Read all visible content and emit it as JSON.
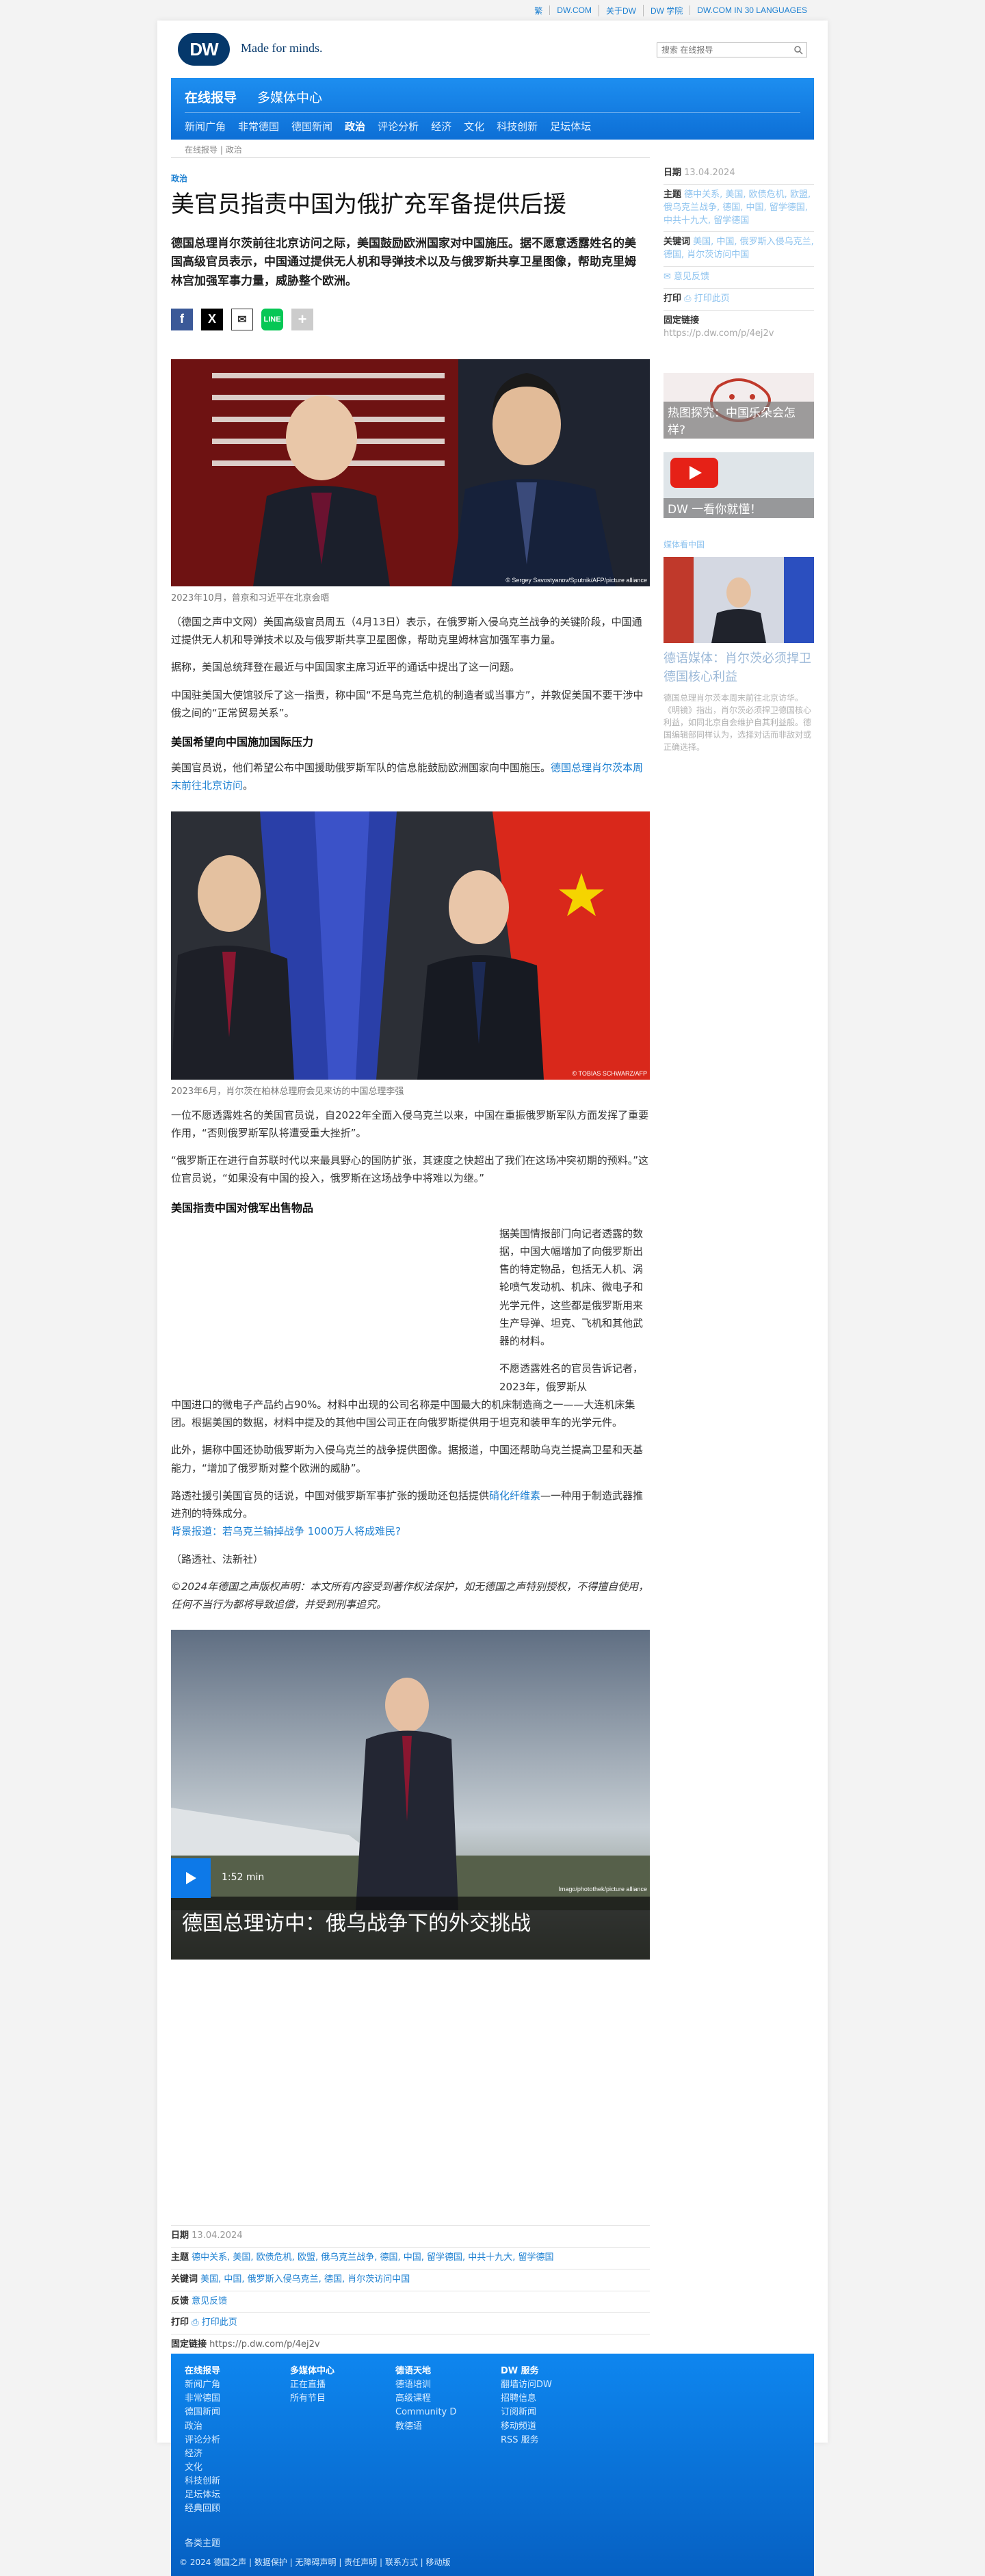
{
  "toplinks": [
    "繁",
    "DW.COM",
    "关于DW",
    "DW 学院",
    "DW.COM IN 30 LANGUAGES"
  ],
  "header": {
    "logo_text": "DW",
    "tagline": "Made for minds.",
    "search_placeholder": "搜索 在线报导"
  },
  "nav": {
    "title": "在线报导",
    "media": "多媒体中心",
    "items": [
      "新闻广角",
      "非常德国",
      "德国新闻",
      "政治",
      "评论分析",
      "经济",
      "文化",
      "科技创新",
      "足坛体坛"
    ],
    "active": "政治"
  },
  "breadcrumb": {
    "home": "在线报导",
    "sep": "|",
    "current": "政治"
  },
  "article": {
    "kicker": "政治",
    "headline": "美官员指责中国为俄扩充军备提供后援",
    "lead": "德国总理肖尔茨前往北京访问之际，美国鼓励欧洲国家对中国施压。据不愿意透露姓名的美国高级官员表示，中国通过提供无人机和导弹技术以及与俄罗斯共享卫星图像，帮助克里姆林宫加强军事力量，威胁整个欧洲。",
    "image1": {
      "caption": "2023年10月，普京和习近平在北京会晤",
      "credit": "© Sergey Savostyanov/Sputnik/AFP/picture alliance"
    },
    "p1": "（德国之声中文网）美国高级官员周五（4月13日）表示，在俄罗斯入侵乌克兰战争的关键阶段，中国通过提供无人机和导弹技术以及与俄罗斯共享卫星图像，帮助克里姆林宫加强军事力量。",
    "p2": "据称，美国总统拜登在最近与中国国家主席习近平的通话中提出了这一问题。",
    "p3": "中国驻美国大使馆驳斥了这一指责，称中国“不是乌克兰危机的制造者或当事方”，并敦促美国不要干涉中俄之间的“正常贸易关系”。",
    "sub1": "美国希望向中国施加国际压力",
    "p4_text": "美国官员说，他们希望公布中国援助俄罗斯军队的信息能鼓励欧洲国家向中国施压。",
    "p4_link": "德国总理肖尔茨本周末前往北京访问",
    "p4_end": "。",
    "image2": {
      "caption": "2023年6月，肖尔茨在柏林总理府会见来访的中国总理李强",
      "credit": "© TOBIAS SCHWARZ/AFP"
    },
    "p5": "一位不愿透露姓名的美国官员说，自2022年全面入侵乌克兰以来，中国在重振俄罗斯军队方面发挥了重要作用，“否则俄罗斯军队将遭受重大挫折”。",
    "p6": "“俄罗斯正在进行自苏联时代以来最具野心的国防扩张，其速度之快超出了我们在这场冲突初期的预料。”这位官员说，“如果没有中国的投入，俄罗斯在这场战争中将难以为继。”",
    "sub2": "美国指责中国对俄军出售物品",
    "p7": "据美国情报部门向记者透露的数据，中国大幅增加了向俄罗斯出售的特定物品，包括无人机、涡轮喷气发动机、机床、微电子和光学元件，这些都是俄罗斯用来生产导弹、坦克、飞机和其他武器的材料。",
    "p8a": "不愿透露姓名的官员告诉记者，2023年，俄罗斯从",
    "p8b": "中国进口的微电子产品约占90%。材料中出现的公司名称是中国最大的机床制造商之一——大连机床集团。根据美国的数据，材料中提及的其他中国公司正在向俄罗斯提供用于坦克和装甲车的光学元件。",
    "p9": "此外，据称中国还协助俄罗斯为入侵乌克兰的战争提供图像。据报道，中国还帮助乌克兰提高卫星和天基能力，“增加了俄罗斯对整个欧洲的威胁”。",
    "p10_text": "路透社援引美国官员的话说，中国对俄罗斯军事扩张的援助还包括提供",
    "p10_link": "硝化纤维素",
    "p10_end": "—一种用于制造武器推进剂的特殊成分。",
    "p11_link": "背景报道：若乌克兰输掉战争 1000万人将成难民?",
    "p12": "（路透社、法新社）",
    "p13": "©2024年德国之声版权声明：本文所有内容受到著作权法保护，如无德国之声特别授权，不得擅自使用，任何不当行为都将导致追偿，并受到刑事追究。",
    "video": {
      "duration": "1:52 min",
      "title": "德国总理访中：俄乌战争下的外交挑战",
      "credit": "Imago/photothek/picture alliance"
    }
  },
  "sidebar": {
    "date_label": "日期",
    "date_val": "13.04.2024",
    "topic_label": "主题",
    "topic_val": "德中关系, 美国, 欧债危机, 欧盟, 俄乌克兰战争, 德国, 中国, 留学德国, 中共十九大, 留学德国",
    "kw_label": "关键词",
    "kw_val": "美国, 中国, 俄罗斯入侵乌克兰, 德国, 肖尔茨访问中国",
    "feedback": "意见反馈",
    "print_label": "打印",
    "print_val": "打印此页",
    "perma_label": "固定链接",
    "perma_val": "https://p.dw.com/p/4ej2v",
    "card1_text": "热图探究：中国乐朵会怎样?",
    "card2_text": "DW 一看你就懂！",
    "media_label": "媒体看中国",
    "card3_title": "德语媒体：肖尔茨必须捍卫德国核心利益",
    "card3_body": "德国总理肖尔茨本周末前往北京访华。《明镜》指出，肖尔茨必须捍卫德国核心利益，如同北京自会维护自其利益般。德国编辑部同样认为，选择对话而非敌对或正确选择。"
  },
  "bottom_meta": {
    "date_label": "日期",
    "date_val": "13.04.2024",
    "topic_label": "主题",
    "topic_val": "德中关系, 美国, 欧债危机, 欧盟, 俄乌克兰战争, 德国, 中国, 留学德国, 中共十九大, 留学德国",
    "kw_label": "关键词",
    "kw_val": "美国, 中国, 俄罗斯入侵乌克兰, 德国, 肖尔茨访问中国",
    "fb_label": "反馈",
    "fb_val": "意见反馈",
    "print_label": "打印",
    "print_val": "打印此页",
    "perma_label": "固定链接",
    "perma_val": "https://p.dw.com/p/4ej2v"
  },
  "footer": {
    "col1": {
      "title": "在线报导",
      "items": [
        "新闻广角",
        "非常德国",
        "德国新闻",
        "政治",
        "评论分析",
        "经济",
        "文化",
        "科技创新",
        "足坛体坛",
        "经典回顾"
      ]
    },
    "col2": {
      "title": "多媒体中心",
      "items": [
        "正在直播",
        "所有节目"
      ]
    },
    "col3": {
      "title": "德语天地",
      "items": [
        "德语培训",
        "高级课程",
        "Community D",
        "教德语"
      ]
    },
    "col4": {
      "title": "DW 服务",
      "items": [
        "翻墙访问DW",
        "招聘信息",
        "订阅新闻",
        "移动频道",
        "RSS 服务"
      ]
    },
    "topics": "各类主题",
    "copyright": "© 2024 德国之声 | 数据保护 | 无障碍声明 | 责任声明 | 联系方式 | 移动版"
  },
  "colors": {
    "brand": "#05386b",
    "nav_blue": "#1d8ef0",
    "link": "#1b7fd1"
  }
}
